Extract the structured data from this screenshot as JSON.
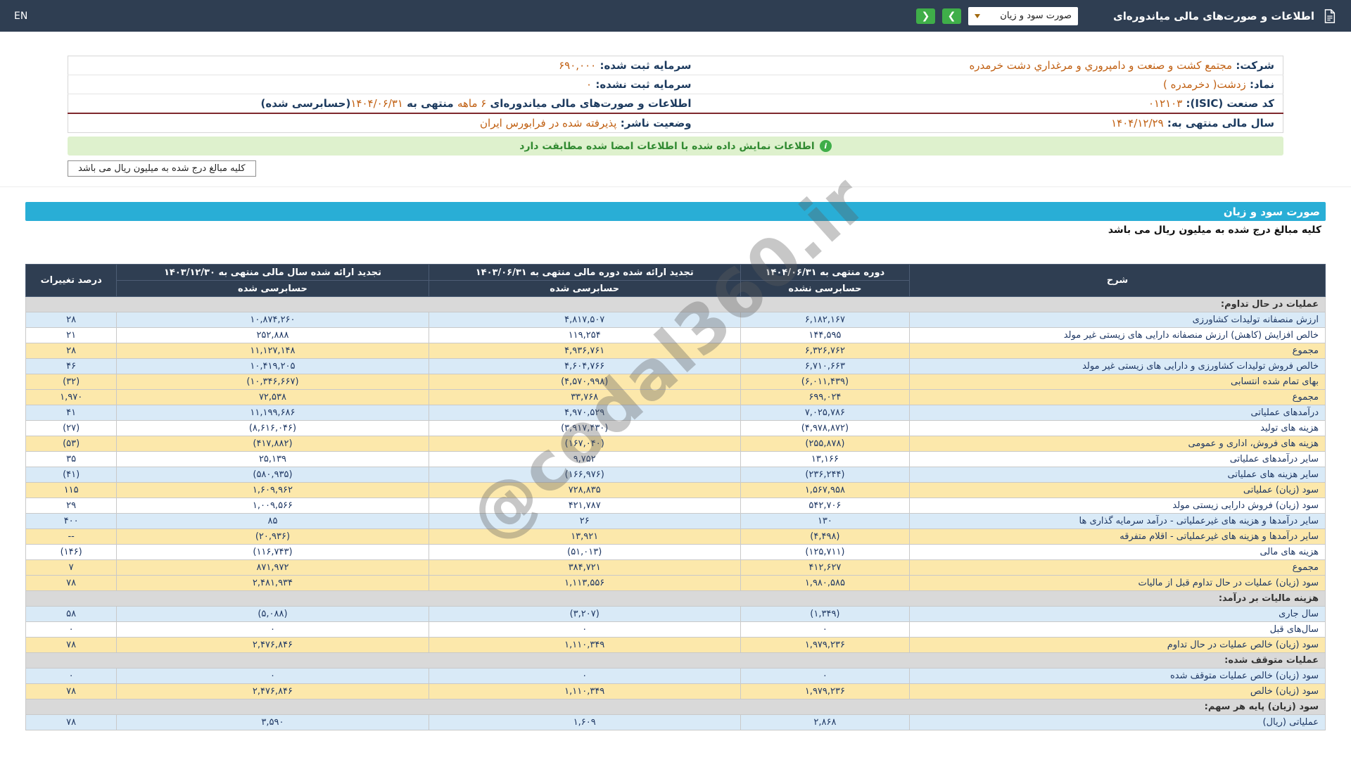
{
  "navbar": {
    "title": "اطلاعات و صورت‌های مالی میاندوره‌ای",
    "statement_dropdown": {
      "selected": "صورت سود و زیان"
    },
    "nav_buttons": {
      "left": "❮",
      "right": "❯"
    },
    "lang_link": "EN"
  },
  "company_info": {
    "rows": [
      {
        "right": [
          {
            "t": "شرکت:  ",
            "k": "label"
          },
          {
            "t": "مجتمع کشت و صنعت و دامپروري و مرغداري دشت خرمدره",
            "k": "value"
          }
        ],
        "left": [
          {
            "t": "سرمایه ثبت شده:  ",
            "k": "label"
          },
          {
            "t": "۶۹۰,۰۰۰",
            "k": "value"
          }
        ],
        "divider": false
      },
      {
        "right": [
          {
            "t": "نماد:  ",
            "k": "label"
          },
          {
            "t": "زدشت( دخرمدره )",
            "k": "value"
          }
        ],
        "left": [
          {
            "t": "سرمایه ثبت نشده:  ",
            "k": "label"
          },
          {
            "t": "۰",
            "k": "value"
          }
        ],
        "divider": false
      },
      {
        "right": [
          {
            "t": "کد صنعت (ISIC):  ",
            "k": "label"
          },
          {
            "t": "۰۱۲۱۰۳",
            "k": "value"
          }
        ],
        "left": [
          {
            "t": "اطلاعات و صورت‌های مالی میاندوره‌ای ",
            "k": "label"
          },
          {
            "t": "۶ ماهه",
            "k": "value"
          },
          {
            "t": " منتهی به ",
            "k": "label"
          },
          {
            "t": "۱۴۰۴/۰۶/۳۱",
            "k": "value"
          },
          {
            "t": "(حسابرسی شده)",
            "k": "label"
          }
        ],
        "divider": false
      },
      {
        "right": [
          {
            "t": "سال مالی منتهی به:  ",
            "k": "label"
          },
          {
            "t": "۱۴۰۴/۱۲/۲۹",
            "k": "value"
          }
        ],
        "left": [
          {
            "t": "وضعیت ناشر:  ",
            "k": "label"
          },
          {
            "t": "پذیرفته شده در فرابورس ایران",
            "k": "value"
          }
        ],
        "divider": true
      }
    ]
  },
  "signature_banner": {
    "text": "اطلاعات نمایش داده شده با اطلاعات امضا شده مطابقت دارد"
  },
  "unit_note_box": "کلیه مبالغ درج شده به میلیون ریال می باشد",
  "statement": {
    "title_bar": "صورت سود و زیان",
    "unit_note": "کلیه مبالغ درج شده به میلیون ریال می باشد",
    "table": {
      "header": {
        "desc": "شرح",
        "cols": [
          {
            "title": "دوره منتهی به ۱۴۰۴/۰۶/۳۱",
            "sub": "حسابرسی نشده"
          },
          {
            "title": "تجدید ارائه شده دوره مالی منتهی به ۱۴۰۳/۰۶/۳۱",
            "sub": "حسابرسی شده"
          },
          {
            "title": "تجدید ارائه شده سال مالی منتهی به ۱۴۰۳/۱۲/۳۰",
            "sub": "حسابرسی شده"
          }
        ],
        "pct": "درصد تغییرات"
      },
      "rows": [
        {
          "type": "section",
          "desc": "عملیات در حال تداوم:"
        },
        {
          "type": "data",
          "style": "blue",
          "desc": "ارزش منصفانه تولیدات کشاورزی",
          "v": [
            "۶,۱۸۲,۱۶۷",
            "۴,۸۱۷,۵۰۷",
            "۱۰,۸۷۴,۲۶۰"
          ],
          "pct": "۲۸"
        },
        {
          "type": "data",
          "style": "white",
          "desc": "خالص افزایش (کاهش) ارزش منصفانه دارایی های زیستی غیر مولد",
          "v": [
            "۱۴۴,۵۹۵",
            "۱۱۹,۲۵۴",
            "۲۵۲,۸۸۸"
          ],
          "pct": "۲۱"
        },
        {
          "type": "data",
          "style": "yellow",
          "desc": "مجموع",
          "v": [
            "۶,۳۲۶,۷۶۲",
            "۴,۹۳۶,۷۶۱",
            "۱۱,۱۲۷,۱۴۸"
          ],
          "pct": "۲۸"
        },
        {
          "type": "data",
          "style": "blue",
          "desc": "خالص فروش تولیدات کشاورزی و دارایی های زیستی غیر مولد",
          "v": [
            "۶,۷۱۰,۶۶۳",
            "۴,۶۰۴,۷۶۶",
            "۱۰,۴۱۹,۲۰۵"
          ],
          "pct": "۴۶"
        },
        {
          "type": "data",
          "style": "yellow",
          "desc": "بهای تمام شده انتسابی",
          "v": [
            "(۶,۰۱۱,۴۳۹)",
            "(۴,۵۷۰,۹۹۸)",
            "(۱۰,۳۴۶,۶۶۷)"
          ],
          "pct": "(۳۲)"
        },
        {
          "type": "data",
          "style": "yellow",
          "desc": "مجموع",
          "v": [
            "۶۹۹,۰۲۴",
            "۳۳,۷۶۸",
            "۷۲,۵۳۸"
          ],
          "pct": "۱,۹۷۰"
        },
        {
          "type": "data",
          "style": "blue",
          "desc": "درآمدهای عملیاتی",
          "v": [
            "۷,۰۲۵,۷۸۶",
            "۴,۹۷۰,۵۲۹",
            "۱۱,۱۹۹,۶۸۶"
          ],
          "pct": "۴۱"
        },
        {
          "type": "data",
          "style": "white",
          "desc": "هزینه های تولید",
          "v": [
            "(۴,۹۷۸,۸۷۲)",
            "(۳,۹۱۷,۴۳۰)",
            "(۸,۶۱۶,۰۴۶)"
          ],
          "pct": "(۲۷)"
        },
        {
          "type": "data",
          "style": "yellow",
          "desc": "هزینه های فروش، اداری و عمومی",
          "v": [
            "(۲۵۵,۸۷۸)",
            "(۱۶۷,۰۴۰)",
            "(۴۱۷,۸۸۲)"
          ],
          "pct": "(۵۳)"
        },
        {
          "type": "data",
          "style": "white",
          "desc": "سایر درآمدهای عملیاتی",
          "v": [
            "۱۳,۱۶۶",
            "۹,۷۵۲",
            "۲۵,۱۳۹"
          ],
          "pct": "۳۵"
        },
        {
          "type": "data",
          "style": "blue",
          "desc": "سایر هزینه های عملیاتی",
          "v": [
            "(۲۳۶,۲۴۴)",
            "(۱۶۶,۹۷۶)",
            "(۵۸۰,۹۳۵)"
          ],
          "pct": "(۴۱)"
        },
        {
          "type": "data",
          "style": "yellow",
          "desc": "سود (زیان) عملیاتی",
          "v": [
            "۱,۵۶۷,۹۵۸",
            "۷۲۸,۸۳۵",
            "۱,۶۰۹,۹۶۲"
          ],
          "pct": "۱۱۵"
        },
        {
          "type": "data",
          "style": "white",
          "desc": "سود (زیان) فروش دارایی زیستی مولد",
          "v": [
            "۵۴۲,۷۰۶",
            "۴۲۱,۷۸۷",
            "۱,۰۰۹,۵۶۶"
          ],
          "pct": "۲۹"
        },
        {
          "type": "data",
          "style": "blue",
          "desc": "سایر درآمدها و هزینه های غیرعملیاتی - درآمد سرمایه گذاری ها",
          "v": [
            "۱۳۰",
            "۲۶",
            "۸۵"
          ],
          "pct": "۴۰۰"
        },
        {
          "type": "data",
          "style": "yellow",
          "desc": "سایر درآمدها و هزینه های غیرعملیاتی - اقلام متفرقه",
          "v": [
            "(۴,۴۹۸)",
            "۱۳,۹۲۱",
            "(۲۰,۹۳۶)"
          ],
          "pct": "--"
        },
        {
          "type": "data",
          "style": "white",
          "desc": "هزینه های مالی",
          "v": [
            "(۱۲۵,۷۱۱)",
            "(۵۱,۰۱۳)",
            "(۱۱۶,۷۴۳)"
          ],
          "pct": "(۱۴۶)"
        },
        {
          "type": "data",
          "style": "yellow",
          "desc": "مجموع",
          "v": [
            "۴۱۲,۶۲۷",
            "۳۸۴,۷۲۱",
            "۸۷۱,۹۷۲"
          ],
          "pct": "۷"
        },
        {
          "type": "data",
          "style": "yellow",
          "desc": "سود (زیان) عملیات در حال تداوم قبل از مالیات",
          "v": [
            "۱,۹۸۰,۵۸۵",
            "۱,۱۱۳,۵۵۶",
            "۲,۴۸۱,۹۳۴"
          ],
          "pct": "۷۸"
        },
        {
          "type": "section",
          "desc": "هزینه مالیات بر درآمد:"
        },
        {
          "type": "data",
          "style": "blue",
          "desc": "سال جاری",
          "v": [
            "(۱,۳۴۹)",
            "(۳,۲۰۷)",
            "(۵,۰۸۸)"
          ],
          "pct": "۵۸"
        },
        {
          "type": "data",
          "style": "white",
          "desc": "سال‌های قبل",
          "v": [
            "۰",
            "۰",
            "۰"
          ],
          "pct": "۰"
        },
        {
          "type": "data",
          "style": "yellow",
          "desc": "سود (زیان) خالص عملیات در حال تداوم",
          "v": [
            "۱,۹۷۹,۲۳۶",
            "۱,۱۱۰,۳۴۹",
            "۲,۴۷۶,۸۴۶"
          ],
          "pct": "۷۸"
        },
        {
          "type": "section",
          "desc": "عملیات متوقف شده:"
        },
        {
          "type": "data",
          "style": "blue",
          "desc": "سود (زیان) خالص عملیات متوقف شده",
          "v": [
            "۰",
            "۰",
            "۰"
          ],
          "pct": "۰"
        },
        {
          "type": "data",
          "style": "yellow",
          "desc": "سود (زیان) خالص",
          "v": [
            "۱,۹۷۹,۲۳۶",
            "۱,۱۱۰,۳۴۹",
            "۲,۴۷۶,۸۴۶"
          ],
          "pct": "۷۸"
        },
        {
          "type": "section",
          "desc": "سود (زیان) پایه هر سهم:"
        },
        {
          "type": "data",
          "style": "blue",
          "desc": "عملیاتی (ریال)",
          "v": [
            "۲,۸۶۸",
            "۱,۶۰۹",
            "۳,۵۹۰"
          ],
          "pct": "۷۸"
        }
      ]
    }
  },
  "watermark": "@codal360.ir",
  "colors": {
    "navbar_bg": "#2f3e52",
    "accent_blue": "#29aed6",
    "row_blue": "#d9eaf7",
    "row_yellow": "#fce8ab",
    "section_gray": "#d9d9d9",
    "negative_red": "#dd0000",
    "value_orange": "#c05f11",
    "success_green": "#3fae49",
    "divider_maroon": "#7e282d"
  }
}
